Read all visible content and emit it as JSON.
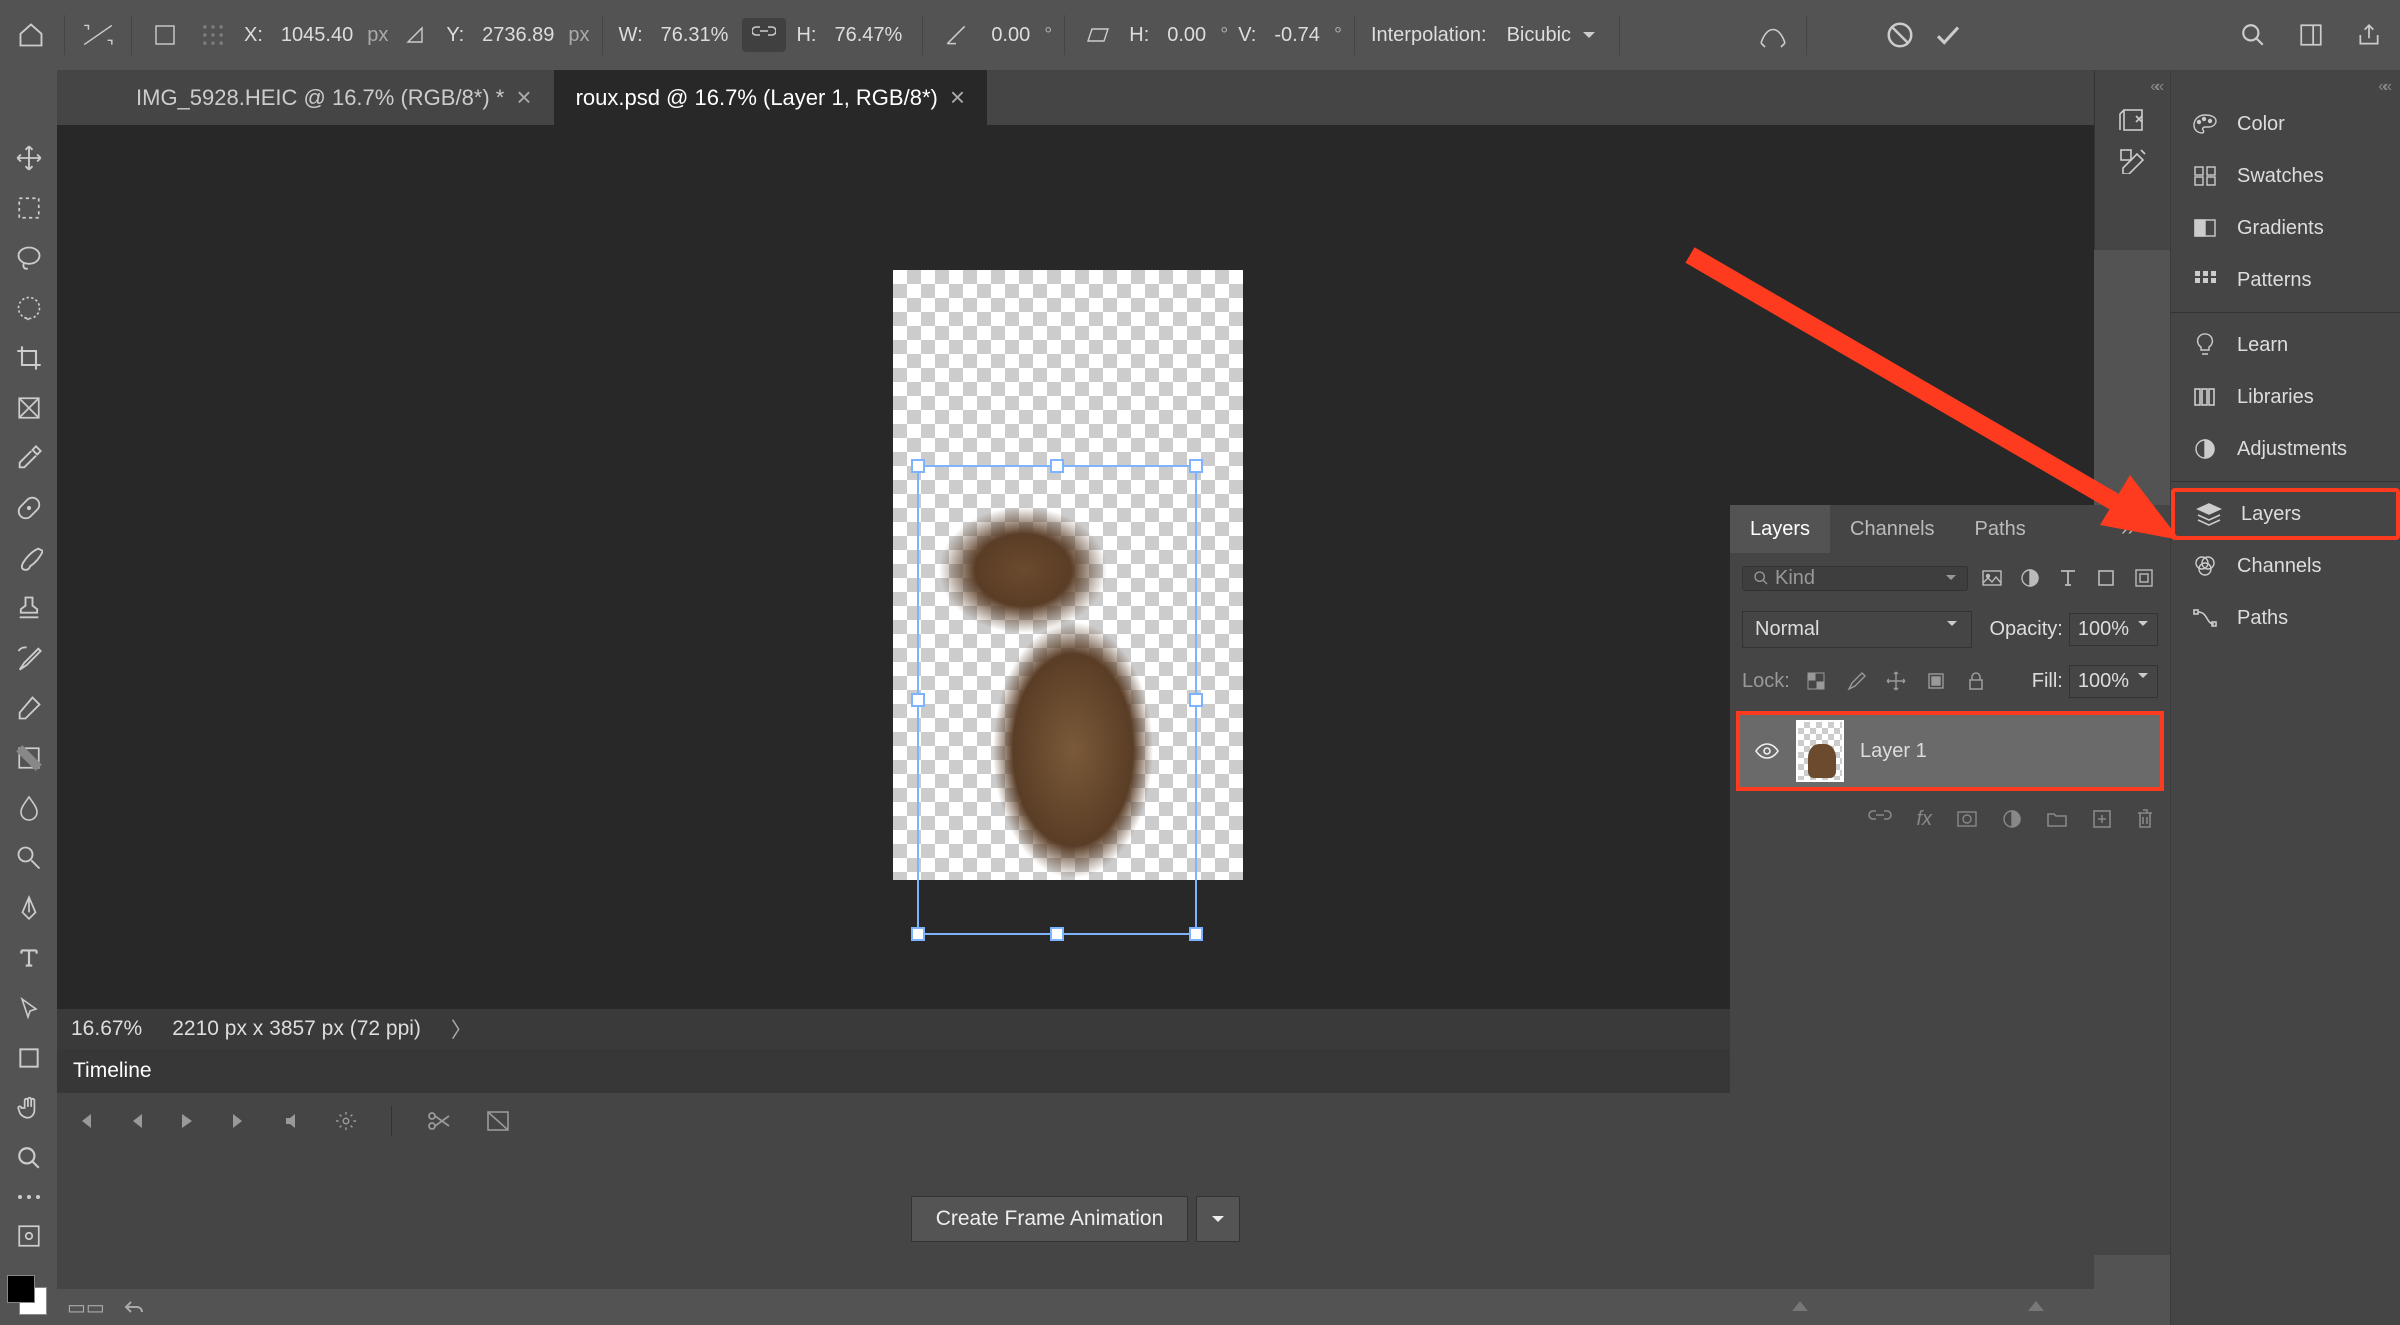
{
  "options_bar": {
    "x_label": "X:",
    "x_value": "1045.40",
    "x_unit": "px",
    "y_label": "Y:",
    "y_value": "2736.89",
    "y_unit": "px",
    "w_label": "W:",
    "w_value": "76.31%",
    "h_label": "H:",
    "h_value": "76.47%",
    "angle_value": "0.00",
    "skew_h_label": "H:",
    "skew_h_value": "0.00",
    "skew_h_unit": "°",
    "skew_v_label": "V:",
    "skew_v_value": "-0.74",
    "skew_v_unit": "°",
    "interp_label": "Interpolation:",
    "interp_value": "Bicubic"
  },
  "tabs": [
    {
      "title": "IMG_5928.HEIC @ 16.7% (RGB/8*)",
      "modified": " *"
    },
    {
      "title": "roux.psd @ 16.7% (Layer 1, RGB/8*)",
      "modified": ""
    }
  ],
  "status": {
    "zoom": "16.67%",
    "dims": "2210 px x 3857 px (72 ppi)"
  },
  "timeline": {
    "tab": "Timeline",
    "frame_btn": "Create Frame Animation"
  },
  "layers_panel": {
    "tabs": {
      "layers": "Layers",
      "channels": "Channels",
      "paths": "Paths"
    },
    "kind_placeholder": "Kind",
    "blend_mode": "Normal",
    "opacity_label": "Opacity:",
    "opacity_value": "100%",
    "lock_label": "Lock:",
    "fill_label": "Fill:",
    "fill_value": "100%",
    "layer_name": "Layer 1"
  },
  "right_dock": {
    "color": "Color",
    "swatches": "Swatches",
    "gradients": "Gradients",
    "patterns": "Patterns",
    "learn": "Learn",
    "libraries": "Libraries",
    "adjustments": "Adjustments",
    "layers": "Layers",
    "channels": "Channels",
    "paths": "Paths"
  }
}
